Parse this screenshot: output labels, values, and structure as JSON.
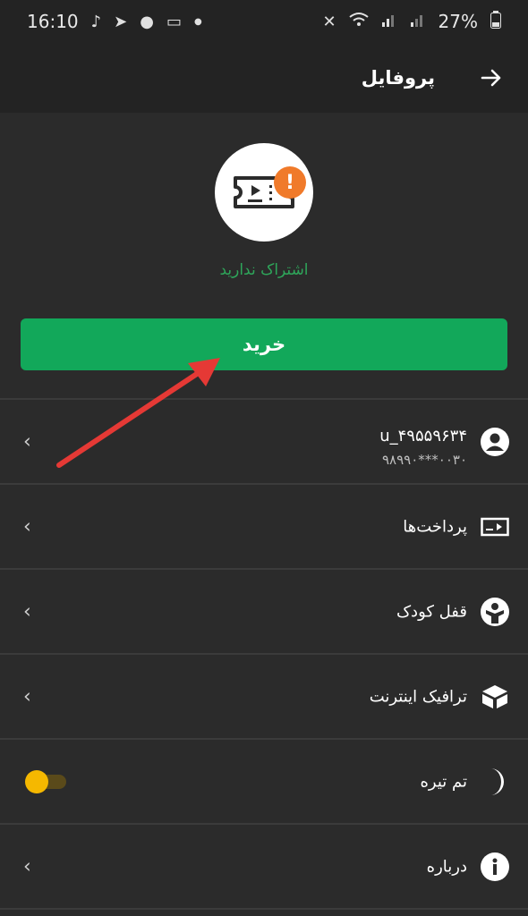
{
  "status_bar": {
    "time": "16:10",
    "battery": "27%",
    "left_icons": [
      "tiktok-icon",
      "telegram-icon",
      "drop-icon",
      "laptop-icon",
      "dot-icon"
    ],
    "right_icons": [
      "mute-icon",
      "wifi-icon",
      "signal-icon",
      "signal-icon",
      "battery-icon"
    ]
  },
  "app_bar": {
    "title": "پروفایل",
    "back_icon": "arrow-right-icon"
  },
  "subscription": {
    "status_text": "اشتراک ندارید",
    "icon": "ticket-play-icon",
    "badge_icon": "exclamation-icon"
  },
  "buy_button": {
    "label": "خرید"
  },
  "menu": {
    "account": {
      "username": "u_۴۹۵۵۹۶۳۴",
      "phone": "۹۸۹۹۰***۰۰۳۰",
      "icon": "account-circle-icon"
    },
    "payments": {
      "label": "پرداخت‌ها",
      "icon": "payment-card-icon"
    },
    "parental_lock": {
      "label": "قفل کودک",
      "icon": "child-icon"
    },
    "traffic": {
      "label": "ترافیک اینترنت",
      "icon": "traffic-cube-icon"
    },
    "dark_theme": {
      "label": "تم تیره",
      "icon": "moon-icon",
      "enabled": true
    },
    "about": {
      "label": "درباره",
      "icon": "info-icon"
    }
  },
  "colors": {
    "background": "#2b2b2b",
    "bar": "#232323",
    "accent_green": "#12a85a",
    "status_green": "#2ea65a",
    "badge_orange": "#f07a2a",
    "toggle_yellow": "#f5b800",
    "annotation_red": "#e53935"
  }
}
